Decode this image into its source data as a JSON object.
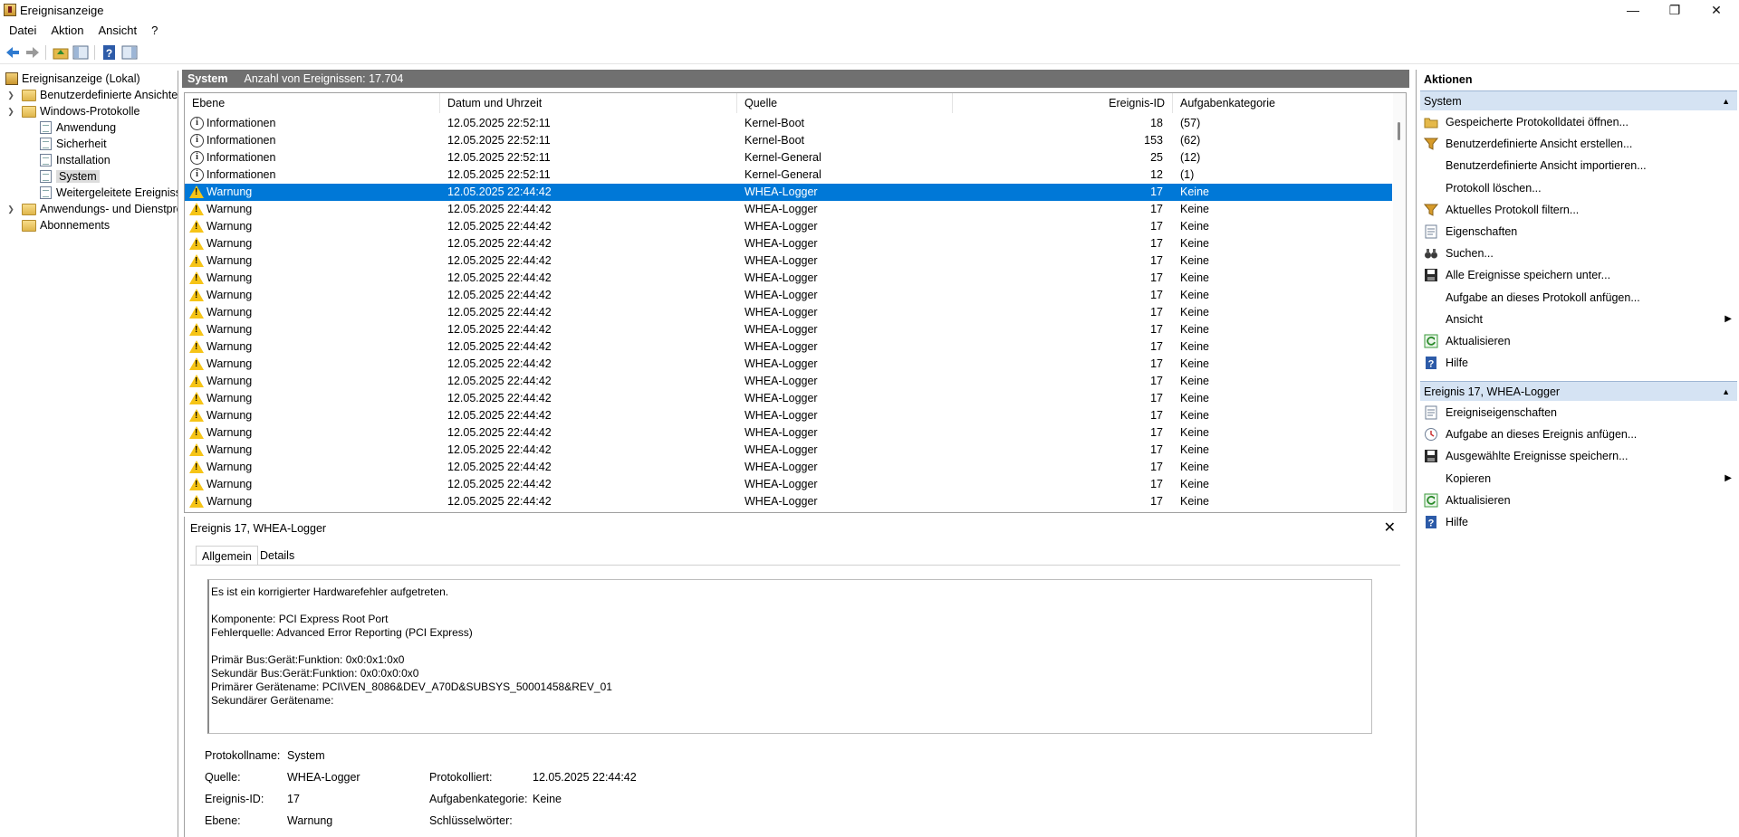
{
  "window": {
    "title": "Ereignisanzeige",
    "controls": [
      "—",
      "❐",
      "✕"
    ]
  },
  "menu": [
    "Datei",
    "Aktion",
    "Ansicht",
    "?"
  ],
  "tree": {
    "root": "Ereignisanzeige (Lokal)",
    "custom_views": "Benutzerdefinierte Ansichten",
    "windows_logs": "Windows-Protokolle",
    "logs": [
      "Anwendung",
      "Sicherheit",
      "Installation",
      "System",
      "Weitergeleitete Ereignisse"
    ],
    "app_service_logs": "Anwendungs- und Dienstprotokolle",
    "subscriptions": "Abonnements"
  },
  "center": {
    "log_name": "System",
    "event_count": "Anzahl von Ereignissen: 17.704"
  },
  "grid": {
    "columns": [
      "Ebene",
      "Datum und Uhrzeit",
      "Quelle",
      "Ereignis-ID",
      "Aufgabenkategorie"
    ],
    "rows": [
      {
        "level": "Informationen",
        "type": "info",
        "date": "12.05.2025 22:52:11",
        "source": "Kernel-Boot",
        "id": "18",
        "cat": "(57)"
      },
      {
        "level": "Informationen",
        "type": "info",
        "date": "12.05.2025 22:52:11",
        "source": "Kernel-Boot",
        "id": "153",
        "cat": "(62)"
      },
      {
        "level": "Informationen",
        "type": "info",
        "date": "12.05.2025 22:52:11",
        "source": "Kernel-General",
        "id": "25",
        "cat": "(12)"
      },
      {
        "level": "Informationen",
        "type": "info",
        "date": "12.05.2025 22:52:11",
        "source": "Kernel-General",
        "id": "12",
        "cat": "(1)"
      },
      {
        "level": "Warnung",
        "type": "warn",
        "date": "12.05.2025 22:44:42",
        "source": "WHEA-Logger",
        "id": "17",
        "cat": "Keine",
        "selected": true
      },
      {
        "level": "Warnung",
        "type": "warn",
        "date": "12.05.2025 22:44:42",
        "source": "WHEA-Logger",
        "id": "17",
        "cat": "Keine"
      },
      {
        "level": "Warnung",
        "type": "warn",
        "date": "12.05.2025 22:44:42",
        "source": "WHEA-Logger",
        "id": "17",
        "cat": "Keine"
      },
      {
        "level": "Warnung",
        "type": "warn",
        "date": "12.05.2025 22:44:42",
        "source": "WHEA-Logger",
        "id": "17",
        "cat": "Keine"
      },
      {
        "level": "Warnung",
        "type": "warn",
        "date": "12.05.2025 22:44:42",
        "source": "WHEA-Logger",
        "id": "17",
        "cat": "Keine"
      },
      {
        "level": "Warnung",
        "type": "warn",
        "date": "12.05.2025 22:44:42",
        "source": "WHEA-Logger",
        "id": "17",
        "cat": "Keine"
      },
      {
        "level": "Warnung",
        "type": "warn",
        "date": "12.05.2025 22:44:42",
        "source": "WHEA-Logger",
        "id": "17",
        "cat": "Keine"
      },
      {
        "level": "Warnung",
        "type": "warn",
        "date": "12.05.2025 22:44:42",
        "source": "WHEA-Logger",
        "id": "17",
        "cat": "Keine"
      },
      {
        "level": "Warnung",
        "type": "warn",
        "date": "12.05.2025 22:44:42",
        "source": "WHEA-Logger",
        "id": "17",
        "cat": "Keine"
      },
      {
        "level": "Warnung",
        "type": "warn",
        "date": "12.05.2025 22:44:42",
        "source": "WHEA-Logger",
        "id": "17",
        "cat": "Keine"
      },
      {
        "level": "Warnung",
        "type": "warn",
        "date": "12.05.2025 22:44:42",
        "source": "WHEA-Logger",
        "id": "17",
        "cat": "Keine"
      },
      {
        "level": "Warnung",
        "type": "warn",
        "date": "12.05.2025 22:44:42",
        "source": "WHEA-Logger",
        "id": "17",
        "cat": "Keine"
      },
      {
        "level": "Warnung",
        "type": "warn",
        "date": "12.05.2025 22:44:42",
        "source": "WHEA-Logger",
        "id": "17",
        "cat": "Keine"
      },
      {
        "level": "Warnung",
        "type": "warn",
        "date": "12.05.2025 22:44:42",
        "source": "WHEA-Logger",
        "id": "17",
        "cat": "Keine"
      },
      {
        "level": "Warnung",
        "type": "warn",
        "date": "12.05.2025 22:44:42",
        "source": "WHEA-Logger",
        "id": "17",
        "cat": "Keine"
      },
      {
        "level": "Warnung",
        "type": "warn",
        "date": "12.05.2025 22:44:42",
        "source": "WHEA-Logger",
        "id": "17",
        "cat": "Keine"
      },
      {
        "level": "Warnung",
        "type": "warn",
        "date": "12.05.2025 22:44:42",
        "source": "WHEA-Logger",
        "id": "17",
        "cat": "Keine"
      },
      {
        "level": "Warnung",
        "type": "warn",
        "date": "12.05.2025 22:44:42",
        "source": "WHEA-Logger",
        "id": "17",
        "cat": "Keine"
      },
      {
        "level": "Warnung",
        "type": "warn",
        "date": "12.05.2025 22:44:42",
        "source": "WHEA-Logger",
        "id": "17",
        "cat": "Keine"
      }
    ]
  },
  "details": {
    "title": "Ereignis 17, WHEA-Logger",
    "close": "✕",
    "tabs": [
      "Allgemein",
      "Details"
    ],
    "description": "Es ist ein korrigierter Hardwarefehler aufgetreten.\n\nKomponente: PCI Express Root Port\nFehlerquelle: Advanced Error Reporting (PCI Express)\n\nPrimär Bus:Gerät:Funktion: 0x0:0x1:0x0\nSekundär Bus:Gerät:Funktion: 0x0:0x0:0x0\nPrimärer Gerätename: PCI\\VEN_8086&DEV_A70D&SUBSYS_50001458&REV_01\nSekundärer Gerätename:",
    "fields": {
      "protokollname_label": "Protokollname:",
      "protokollname": "System",
      "quelle_label": "Quelle:",
      "quelle": "WHEA-Logger",
      "protokolliert_label": "Protokolliert:",
      "protokolliert": "12.05.2025 22:44:42",
      "ereignis_id_label": "Ereignis-ID:",
      "ereignis_id": "17",
      "aufgabenkategorie_label": "Aufgabenkategorie:",
      "aufgabenkategorie": "Keine",
      "ebene_label": "Ebene:",
      "ebene": "Warnung",
      "schluesselwoerter_label": "Schlüsselwörter:"
    }
  },
  "actions": {
    "title": "Aktionen",
    "section1": "System",
    "items1": [
      {
        "label": "Gespeicherte Protokolldatei öffnen...",
        "icon": "open-folder-icon"
      },
      {
        "label": "Benutzerdefinierte Ansicht erstellen...",
        "icon": "filter-icon"
      },
      {
        "label": "Benutzerdefinierte Ansicht importieren...",
        "icon": ""
      },
      {
        "label": "Protokoll löschen...",
        "icon": ""
      },
      {
        "label": "Aktuelles Protokoll filtern...",
        "icon": "filter-icon"
      },
      {
        "label": "Eigenschaften",
        "icon": "properties-icon"
      },
      {
        "label": "Suchen...",
        "icon": "binoculars-icon"
      },
      {
        "label": "Alle Ereignisse speichern unter...",
        "icon": "save-icon"
      },
      {
        "label": "Aufgabe an dieses Protokoll anfügen...",
        "icon": ""
      },
      {
        "label": "Ansicht",
        "icon": "",
        "submenu": true
      },
      {
        "label": "Aktualisieren",
        "icon": "refresh-icon"
      },
      {
        "label": "Hilfe",
        "icon": "help-icon"
      }
    ],
    "section2": "Ereignis 17, WHEA-Logger",
    "items2": [
      {
        "label": "Ereigniseigenschaften",
        "icon": "properties-icon"
      },
      {
        "label": "Aufgabe an dieses Ereignis anfügen...",
        "icon": "task-icon"
      },
      {
        "label": "Ausgewählte Ereignisse speichern...",
        "icon": "save-icon"
      },
      {
        "label": "Kopieren",
        "icon": "",
        "submenu": true
      },
      {
        "label": "Aktualisieren",
        "icon": "refresh-icon"
      },
      {
        "label": "Hilfe",
        "icon": "help-icon"
      }
    ]
  }
}
